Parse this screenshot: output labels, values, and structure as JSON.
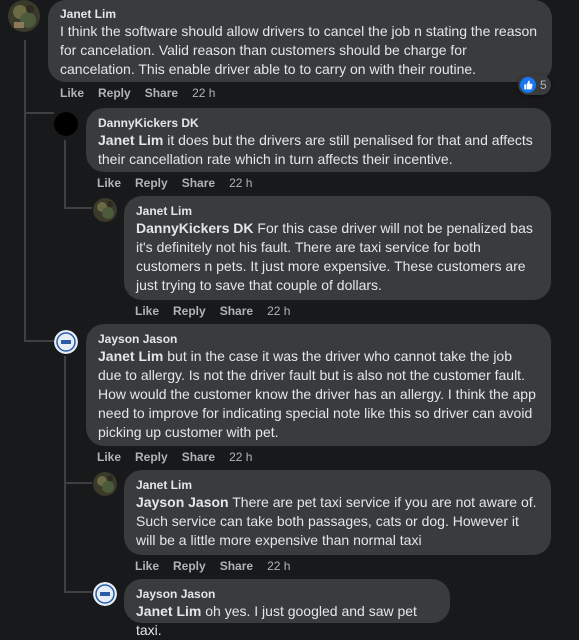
{
  "colors": {
    "background": "#18191a",
    "bubble": "#3a3b3c",
    "text": "#e4e6eb",
    "muted": "#b0b3b8",
    "like_blue": "#1877f2"
  },
  "actions": {
    "like": "Like",
    "reply": "Reply",
    "share": "Share"
  },
  "comments": [
    {
      "author": "Janet Lim",
      "mention": "",
      "text": "I think the software should allow drivers to cancel the job n stating the reason for cancelation. Valid reason than customers should be charge for cancelation. This enable driver able to to carry on with their routine.",
      "time": "22 h",
      "reaction_icon": "like-icon",
      "reaction_count": "5"
    },
    {
      "author": "DannyKickers DK",
      "mention": "Janet Lim",
      "text": " it does but the drivers are still penalised for that and affects their cancellation rate which in turn affects their incentive.",
      "time": "22 h"
    },
    {
      "author": "Janet Lim",
      "mention": "DannyKickers DK",
      "text": " For this case driver will not be penalized bas it's definitely not his fault. There are taxi service for both customers n pets. It just more expensive. These customers are just trying to save that couple of dollars.",
      "time": "22 h"
    },
    {
      "author": "Jayson Jason",
      "mention": "Janet Lim",
      "text": " but in the case it was the driver who cannot take the job due to allergy. Is not the driver fault but is also not the customer fault. How would the customer know the driver has an allergy. I think the app need to improve for indicating special note like this so driver can avoid picking up customer with pet.",
      "time": "22 h"
    },
    {
      "author": "Janet Lim",
      "mention": "Jayson Jason",
      "text": " There are pet taxi service if you are not aware of. Such service can take both passages, cats or dog. However it will be a little more expensive than normal taxi",
      "time": "22 h"
    },
    {
      "author": "Jayson Jason",
      "mention": "Janet Lim",
      "text": " oh yes. I just googled and saw pet taxi.",
      "time": ""
    }
  ]
}
